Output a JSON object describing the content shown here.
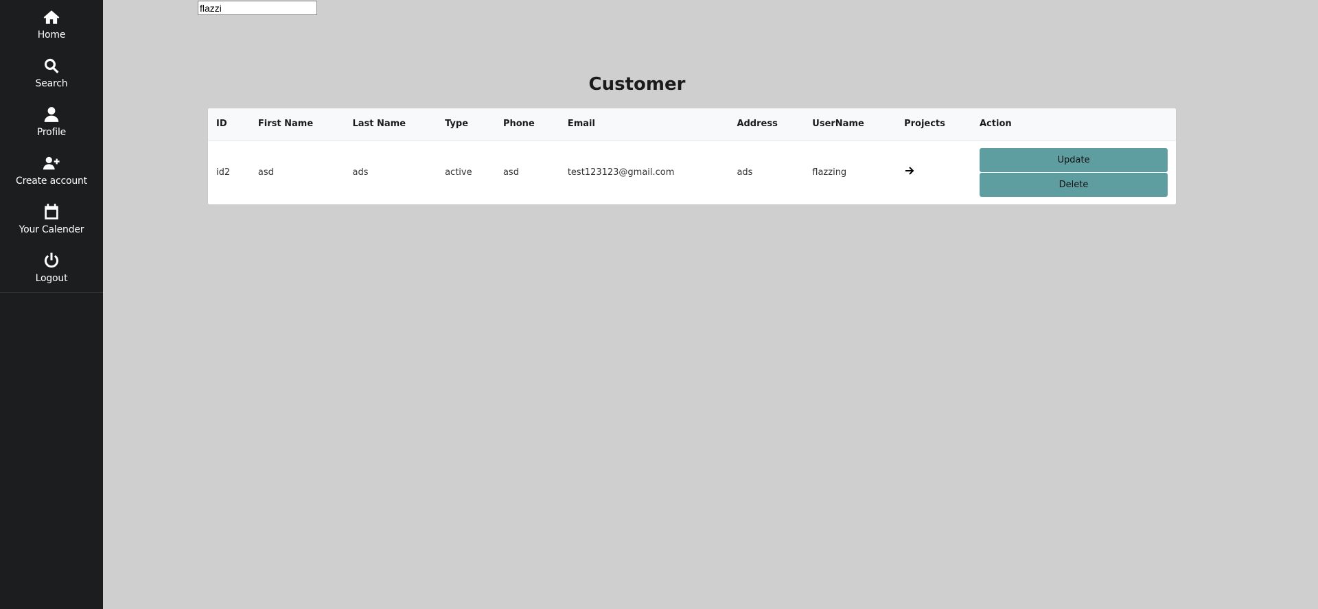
{
  "sidebar": {
    "items": [
      {
        "label": "Home",
        "icon": "home-icon"
      },
      {
        "label": "Search",
        "icon": "search-icon"
      },
      {
        "label": "Profile",
        "icon": "user-icon"
      },
      {
        "label": "Create account",
        "icon": "user-plus-icon"
      },
      {
        "label": "Your Calender",
        "icon": "calendar-icon"
      },
      {
        "label": "Logout",
        "icon": "power-icon"
      }
    ]
  },
  "search": {
    "value": "flazzi"
  },
  "page": {
    "title": "Customer"
  },
  "table": {
    "headers": [
      "ID",
      "First Name",
      "Last Name",
      "Type",
      "Phone",
      "Email",
      "Address",
      "UserName",
      "Projects",
      "Action"
    ],
    "rows": [
      {
        "id": "id2",
        "first_name": "asd",
        "last_name": "ads",
        "type": "active",
        "phone": "asd",
        "email": "test123123@gmail.com",
        "address": "ads",
        "username": "flazzing",
        "projects_icon": "arrow-right-icon",
        "update_label": "Update",
        "delete_label": "Delete"
      }
    ]
  },
  "colors": {
    "sidebar_bg": "#1c1d1f",
    "page_bg": "#d0cfcf",
    "button_bg": "#5f9ea0"
  }
}
